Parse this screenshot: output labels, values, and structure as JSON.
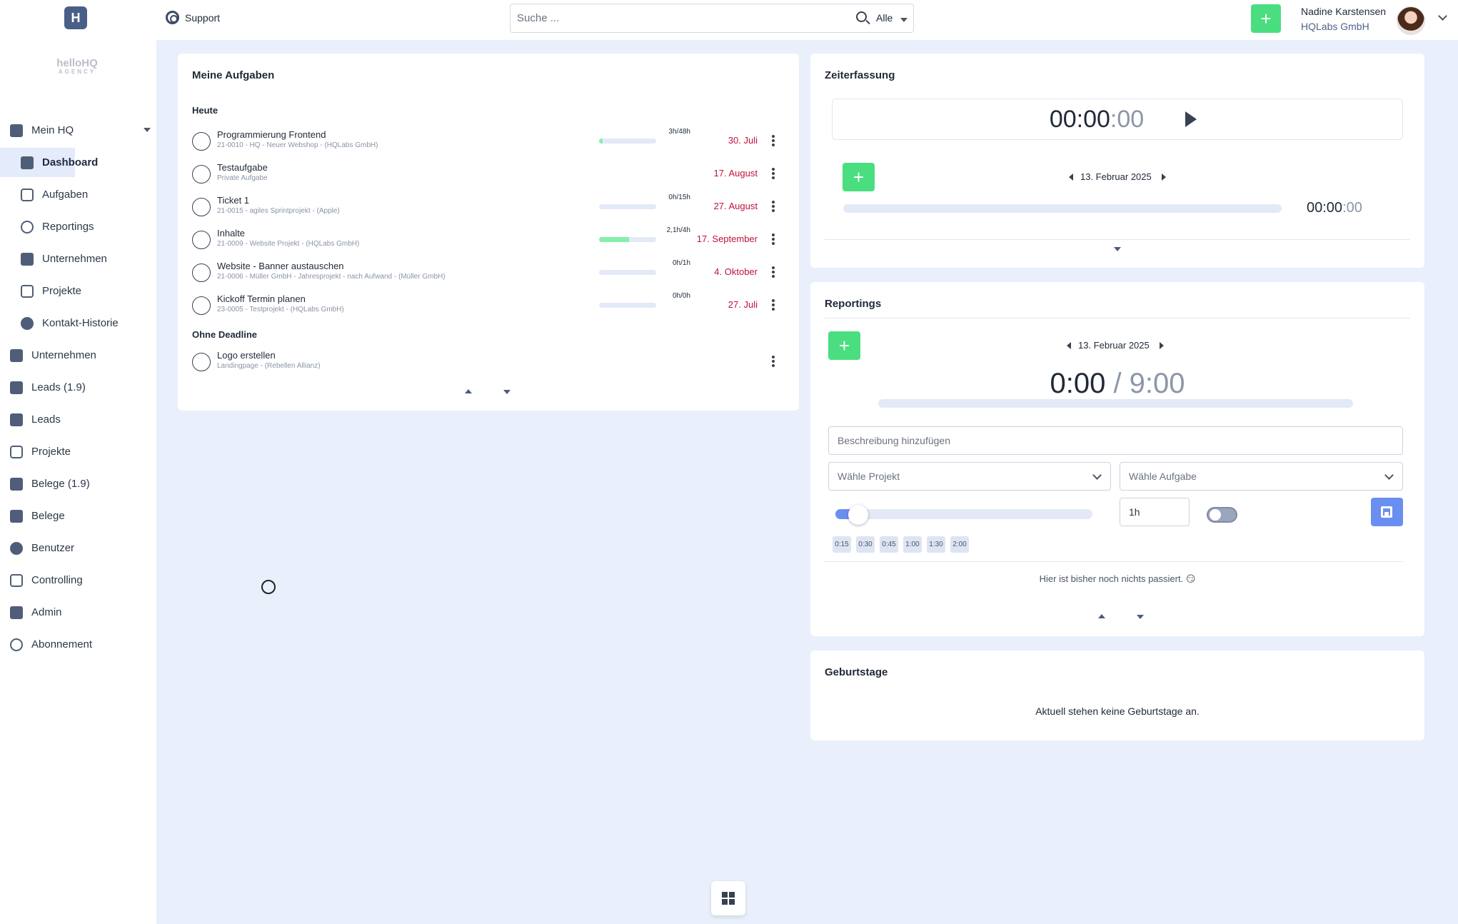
{
  "brand": {
    "logo_letter": "H",
    "name": "helloHQ",
    "tagline": "AGENCY"
  },
  "sidebar": {
    "items": [
      {
        "label": "Mein HQ",
        "icon": "home-people-icon",
        "expandable": true
      },
      {
        "label": "Dashboard",
        "icon": "dashboard-icon",
        "sub": true,
        "active": true
      },
      {
        "label": "Aufgaben",
        "icon": "clipboard-check-icon",
        "sub": true
      },
      {
        "label": "Reportings",
        "icon": "stopwatch-icon",
        "sub": true
      },
      {
        "label": "Unternehmen",
        "icon": "building-icon",
        "sub": true
      },
      {
        "label": "Projekte",
        "icon": "project-icon",
        "sub": true
      },
      {
        "label": "Kontakt-Historie",
        "icon": "contact-history-icon",
        "sub": true
      },
      {
        "label": "Unternehmen",
        "icon": "building-icon"
      },
      {
        "label": "Leads (1.9)",
        "icon": "leads-icon"
      },
      {
        "label": "Leads",
        "icon": "leads-icon"
      },
      {
        "label": "Projekte",
        "icon": "project-icon"
      },
      {
        "label": "Belege (1.9)",
        "icon": "document-icon"
      },
      {
        "label": "Belege",
        "icon": "document-icon"
      },
      {
        "label": "Benutzer",
        "icon": "users-icon"
      },
      {
        "label": "Controlling",
        "icon": "presentation-icon"
      },
      {
        "label": "Admin",
        "icon": "tools-icon"
      },
      {
        "label": "Abonnement",
        "icon": "subscription-icon"
      }
    ]
  },
  "topbar": {
    "support_label": "Support",
    "search_placeholder": "Suche ...",
    "search_scope": "Alle",
    "user_name": "Nadine Karstensen",
    "user_company": "HQLabs GmbH",
    "colors": {
      "accent_green": "#4ade80",
      "accent_blue": "#6b8ff0",
      "due_red": "#be123c"
    }
  },
  "tasks": {
    "title": "Meine Aufgaben",
    "today_label": "Heute",
    "no_deadline_label": "Ohne Deadline",
    "today": [
      {
        "name": "Programmierung Frontend",
        "sub": "21-0010 - HQ - Neuer Webshop - (HQLabs GmbH)",
        "hours": "3h/48h",
        "progress": 0.06,
        "due": "30. Juli"
      },
      {
        "name": "Testaufgabe",
        "sub": "Private Aufgabe",
        "hours": "",
        "progress": null,
        "due": "17. August"
      },
      {
        "name": "Ticket 1",
        "sub": "21-0015 - agiles Sprintprojekt - (Apple)",
        "hours": "0h/15h",
        "progress": 0,
        "due": "27. August"
      },
      {
        "name": "Inhalte",
        "sub": "21-0009 - Website Projekt - (HQLabs GmbH)",
        "hours": "2,1h/4h",
        "progress": 0.52,
        "due": "17. September"
      },
      {
        "name": "Website - Banner austauschen",
        "sub": "21-0006 - Müller GmbH - Jahresprojekt - nach Aufwand - (Müller GmbH)",
        "hours": "0h/1h",
        "progress": 0,
        "due": "4. Oktober"
      },
      {
        "name": "Kickoff Termin planen",
        "sub": "23-0005 - Testprojekt - (HQLabs GmbH)",
        "hours": "0h/0h",
        "progress": 0,
        "due": "27. Juli"
      }
    ],
    "no_deadline": [
      {
        "name": "Logo erstellen",
        "sub": "Landingpage - (Rebellen Allianz)"
      }
    ]
  },
  "time_tracking": {
    "title": "Zeiterfassung",
    "timer_main": "00:00",
    "timer_seconds": ":00",
    "date": "13. Februar 2025",
    "small_timer_main": "00:00",
    "small_timer_seconds": ":00",
    "progress": 0
  },
  "reportings": {
    "title": "Reportings",
    "date": "13. Februar 2025",
    "logged": "0:00",
    "separator": " / ",
    "target": "9:00",
    "progress": 0,
    "description_placeholder": "Beschreibung hinzufügen",
    "project_select": "Wähle Projekt",
    "task_select": "Wähle Aufgabe",
    "duration_value": "1h",
    "slider_level": 0.05,
    "toggle_on": false,
    "quick_times": [
      "0:15",
      "0:30",
      "0:45",
      "1:00",
      "1:30",
      "2:00"
    ],
    "empty_message": "Hier ist bisher noch nichts passiert. 😏"
  },
  "birthdays": {
    "title": "Geburtstage",
    "empty_message": "Aktuell stehen keine Geburtstage an."
  }
}
